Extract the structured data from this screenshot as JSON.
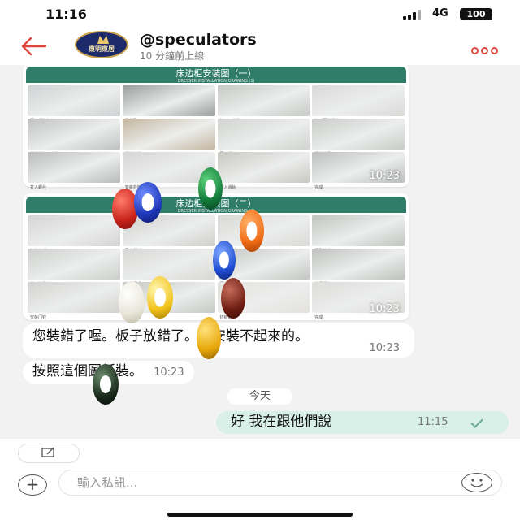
{
  "status_bar": {
    "time": "11:16",
    "network": "4G",
    "battery": "100"
  },
  "header": {
    "contact_name": "@speculators",
    "contact_status": "10 分鐘前上線",
    "avatar_text": "東明東居"
  },
  "messages": {
    "image_1": {
      "sheet_title": "床边柜安装图（一）",
      "sheet_subtitle": "DRESSER INSTALLATION DRAWING (1)",
      "time": "10:23",
      "photos": [
        {
          "color": "#cfd2d3",
          "caption": "展开纸箱包"
        },
        {
          "color": "#9a9d9c",
          "caption": "零件展示"
        },
        {
          "color": "#c7c9c6",
          "caption": "放入五金件"
        },
        {
          "color": "#d9dad8",
          "caption": "打入预制螺丝钉"
        },
        {
          "color": "#bfc2c0",
          "caption": "将板材按方向拼"
        },
        {
          "color": "#c4b6a0",
          "caption": "侧板安装"
        },
        {
          "color": "#d1d3d0",
          "caption": "固定螺丝"
        },
        {
          "color": "#c9cbc8",
          "caption": "组装抽屉"
        },
        {
          "color": "#b8bbb8",
          "caption": "打入螺丝"
        },
        {
          "color": "#d5d6d4",
          "caption": "安装背板"
        },
        {
          "color": "#c8c7c2",
          "caption": "装入滑轨"
        },
        {
          "color": "#bcbfbc",
          "caption": "完成"
        }
      ]
    },
    "image_2": {
      "sheet_title": "床边柜安装图（二）",
      "sheet_subtitle": "DRESSER INSTALLATION DRAWING (2)",
      "time": "10:23",
      "photos": [
        {
          "color": "#d4d5d3",
          "caption": "安装底板"
        },
        {
          "color": "#cfd0cd",
          "caption": "固定侧板"
        },
        {
          "color": "#d9dad7",
          "caption": "安装门板"
        },
        {
          "color": "#c2c4c1",
          "caption": "调整铰链"
        },
        {
          "color": "#cdcfcc",
          "caption": "装入抽屉"
        },
        {
          "color": "#d7d8d5",
          "caption": "安装把手"
        },
        {
          "color": "#c4c6c3",
          "caption": "固定背板"
        },
        {
          "color": "#bfc1be",
          "caption": "锁紧螺丝"
        },
        {
          "color": "#d2d3d0",
          "caption": "安装门铰"
        },
        {
          "color": "#c6c8c5",
          "caption": "放入隔板"
        },
        {
          "color": "#e3e1dc",
          "caption": "铰链说明"
        },
        {
          "color": "#dcdcd9",
          "caption": "完成"
        }
      ]
    },
    "msg_1": {
      "text": "您裝錯了喔。板子放錯了。是安裝不起來的。",
      "time": "10:23"
    },
    "msg_2": {
      "text": "按照這個圖紙裝。",
      "time": "10:23"
    },
    "date_divider": "今天",
    "msg_out": {
      "text": "好 我在跟他們說",
      "time": "11:15"
    }
  },
  "input": {
    "placeholder": "輸入私訊..."
  },
  "colors": {
    "accent": "#e0463c",
    "outgoing_bubble": "#d8f0e7",
    "sheet_header": "#2f7d68",
    "chat_background": "#f2f2f2"
  },
  "icons": [
    "back-arrow-icon",
    "more-dots-icon",
    "edit-icon",
    "add-circle-icon",
    "emoji-icon",
    "read-check-icon"
  ]
}
